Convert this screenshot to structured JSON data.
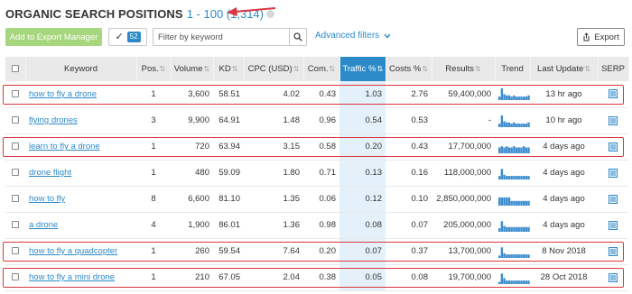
{
  "header": {
    "title": "ORGANIC SEARCH POSITIONS",
    "range": "1 - 100 (1,314)"
  },
  "toolbar": {
    "add_export_label": "Add to Export Manager",
    "selected_count": "52",
    "filter_placeholder": "Filter by keyword",
    "advanced_filters_label": "Advanced filters",
    "export_label": "Export"
  },
  "columns": [
    "Keyword",
    "Pos.",
    "Volume",
    "KD",
    "CPC (USD)",
    "Com.",
    "Traffic %",
    "Costs %",
    "Results",
    "Trend",
    "Last Update",
    "SERP"
  ],
  "sorted_column": "Traffic %",
  "rows": [
    {
      "keyword": "how to fly a drone",
      "pos": "1",
      "volume": "3,600",
      "kd": "58.51",
      "cpc": "4.02",
      "com": "0.43",
      "traffic": "1.03",
      "costs": "2.76",
      "results": "59,400,000",
      "updated": "13 hr ago",
      "highlighted": true,
      "trend": [
        3,
        10,
        5,
        4,
        4,
        3,
        4,
        3,
        3,
        3,
        3,
        3,
        4
      ]
    },
    {
      "keyword": "flying drones",
      "pos": "3",
      "volume": "9,900",
      "kd": "64.91",
      "cpc": "1.48",
      "com": "0.96",
      "traffic": "0.54",
      "costs": "0.53",
      "results": "-",
      "updated": "10 hr ago",
      "highlighted": false,
      "trend": [
        3,
        10,
        5,
        4,
        4,
        3,
        4,
        3,
        3,
        3,
        3,
        3,
        4
      ]
    },
    {
      "keyword": "learn to fly a drone",
      "pos": "1",
      "volume": "720",
      "kd": "63.94",
      "cpc": "3.15",
      "com": "0.58",
      "traffic": "0.20",
      "costs": "0.43",
      "results": "17,700,000",
      "updated": "4 days ago",
      "highlighted": true,
      "trend": [
        5,
        6,
        5,
        6,
        5,
        5,
        6,
        5,
        5,
        5,
        6,
        5,
        5
      ]
    },
    {
      "keyword": "drone flight",
      "pos": "1",
      "volume": "480",
      "kd": "59.09",
      "cpc": "1.80",
      "com": "0.71",
      "traffic": "0.13",
      "costs": "0.16",
      "results": "118,000,000",
      "updated": "4 days ago",
      "highlighted": false,
      "trend": [
        3,
        9,
        4,
        3,
        3,
        3,
        3,
        3,
        3,
        3,
        3,
        3,
        3
      ]
    },
    {
      "keyword": "how to fly",
      "pos": "8",
      "volume": "6,600",
      "kd": "81.10",
      "cpc": "1.35",
      "com": "0.06",
      "traffic": "0.12",
      "costs": "0.10",
      "results": "2,850,000,000",
      "updated": "4 days ago",
      "highlighted": false,
      "trend": [
        7,
        7,
        7,
        7,
        7,
        4,
        4,
        4,
        4,
        4,
        4,
        4,
        4
      ]
    },
    {
      "keyword": "a drone",
      "pos": "4",
      "volume": "1,900",
      "kd": "86.01",
      "cpc": "1.36",
      "com": "0.98",
      "traffic": "0.08",
      "costs": "0.07",
      "results": "205,000,000",
      "updated": "4 days ago",
      "highlighted": false,
      "trend": [
        3,
        9,
        5,
        4,
        4,
        4,
        4,
        4,
        4,
        4,
        4,
        4,
        4
      ]
    },
    {
      "keyword": "how to fly a quadcopter",
      "pos": "1",
      "volume": "260",
      "kd": "59.54",
      "cpc": "7.64",
      "com": "0.20",
      "traffic": "0.07",
      "costs": "0.37",
      "results": "13,700,000",
      "updated": "8 Nov 2018",
      "highlighted": true,
      "trend": [
        2,
        9,
        4,
        3,
        3,
        3,
        3,
        3,
        3,
        3,
        3,
        3,
        3
      ]
    },
    {
      "keyword": "how to fly a mini drone",
      "pos": "1",
      "volume": "210",
      "kd": "67.05",
      "cpc": "2.04",
      "com": "0.38",
      "traffic": "0.05",
      "costs": "0.08",
      "results": "19,700,000",
      "updated": "28 Oct 2018",
      "highlighted": true,
      "trend": [
        2,
        9,
        5,
        3,
        3,
        3,
        3,
        3,
        3,
        3,
        3,
        3,
        3
      ]
    }
  ],
  "colors": {
    "accent": "#2d8ac9",
    "highlight": "#d9363e",
    "export_btn": "#a6d67d",
    "trend": "#3b8dd0"
  },
  "icons": [
    "help-icon",
    "check-icon",
    "search-icon",
    "chevron-down-icon",
    "export-icon",
    "serp-icon"
  ]
}
